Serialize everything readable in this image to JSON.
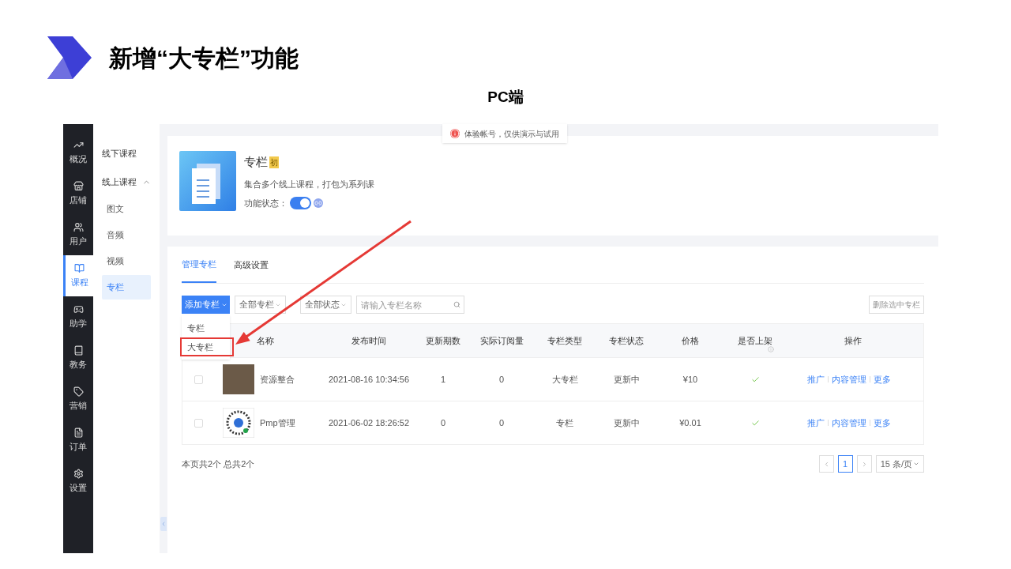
{
  "slide": {
    "title": "新增“大专栏”功能",
    "subtitle": "PC端"
  },
  "rail": [
    {
      "label": "概况",
      "selected": false
    },
    {
      "label": "店铺",
      "selected": false
    },
    {
      "label": "用户",
      "selected": false
    },
    {
      "label": "课程",
      "selected": true
    },
    {
      "label": "助学",
      "selected": false
    },
    {
      "label": "教务",
      "selected": false
    },
    {
      "label": "营销",
      "selected": false
    },
    {
      "label": "订单",
      "selected": false
    },
    {
      "label": "设置",
      "selected": false
    }
  ],
  "sidebar": {
    "items": [
      {
        "label": "线下课程",
        "selected": false
      },
      {
        "label": "线上课程",
        "selected": false,
        "expanded": true,
        "children": [
          {
            "label": "图文",
            "selected": false
          },
          {
            "label": "音频",
            "selected": false
          },
          {
            "label": "视频",
            "selected": false
          },
          {
            "label": "专栏",
            "selected": true
          }
        ]
      }
    ]
  },
  "notice": "体验帐号，仅供演示与试用",
  "feature": {
    "title": "专栏",
    "badge": "初",
    "description": "集合多个线上课程，打包为系列课",
    "status_label": "功能状态：",
    "on": true
  },
  "tabs": [
    {
      "label": "管理专栏",
      "selected": true
    },
    {
      "label": "高级设置",
      "selected": false
    }
  ],
  "toolbar": {
    "add_button": "添加专栏",
    "filters": [
      "全部专栏",
      "全部状态"
    ],
    "search": {
      "placeholder": "请输入专栏名称"
    },
    "delete_button": "删除选中专栏"
  },
  "add_menu": [
    {
      "label": "专栏",
      "highlighted": false
    },
    {
      "label": "大专栏",
      "highlighted": true
    }
  ],
  "table": {
    "columns": [
      "名称",
      "发布时间",
      "更新期数",
      "实际订阅量",
      "专栏类型",
      "专栏状态",
      "价格",
      "是否上架",
      "操作"
    ],
    "rows": [
      {
        "selected": false,
        "kind": "photo",
        "name": "资源整合",
        "published": "2021-08-16 10:34:56",
        "issues": "1",
        "subscribers": "0",
        "type": "大专栏",
        "status": "更新中",
        "price": "¥10",
        "listed": true,
        "actions": [
          "推广",
          "内容管理",
          "更多"
        ]
      },
      {
        "selected": false,
        "kind": "qr",
        "name": "Pmp管理",
        "published": "2021-06-02 18:26:52",
        "issues": "0",
        "subscribers": "0",
        "type": "专栏",
        "status": "更新中",
        "price": "¥0.01",
        "listed": true,
        "actions": [
          "推广",
          "内容管理",
          "更多"
        ]
      }
    ]
  },
  "footer": {
    "summary": "本页共2个 总共2个",
    "pages": [
      {
        "label": "1",
        "selected": true
      }
    ],
    "page_size": "15 条/页"
  }
}
